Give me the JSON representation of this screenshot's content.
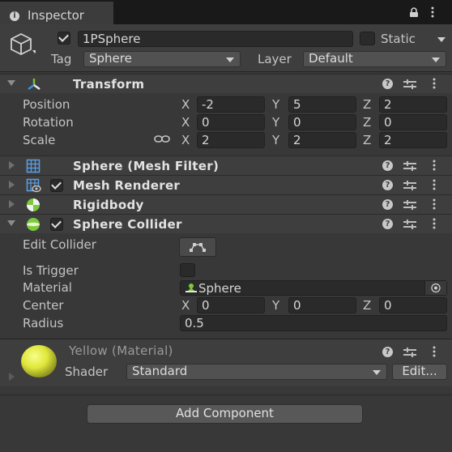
{
  "tab": {
    "title": "Inspector"
  },
  "gameobject": {
    "active": true,
    "name": "1PSphere",
    "static_label": "Static",
    "static_checked": false,
    "tag_label": "Tag",
    "tag_value": "Sphere",
    "layer_label": "Layer",
    "layer_value": "Default"
  },
  "transform": {
    "title": "Transform",
    "position_label": "Position",
    "rotation_label": "Rotation",
    "scale_label": "Scale",
    "axis_x": "X",
    "axis_y": "Y",
    "axis_z": "Z",
    "position": {
      "x": "-2",
      "y": "5",
      "z": "2"
    },
    "rotation": {
      "x": "0",
      "y": "0",
      "z": "0"
    },
    "scale": {
      "x": "2",
      "y": "2",
      "z": "2"
    }
  },
  "mesh_filter": {
    "title": "Sphere (Mesh Filter)"
  },
  "mesh_renderer": {
    "title": "Mesh Renderer",
    "enabled": true
  },
  "rigidbody": {
    "title": "Rigidbody"
  },
  "sphere_collider": {
    "title": "Sphere Collider",
    "enabled": true,
    "edit_collider_label": "Edit Collider",
    "is_trigger_label": "Is Trigger",
    "is_trigger": false,
    "material_label": "Material",
    "material_value": "Sphere",
    "center_label": "Center",
    "center": {
      "x": "0",
      "y": "0",
      "z": "0"
    },
    "radius_label": "Radius",
    "radius": "0.5"
  },
  "material": {
    "title": "Yellow (Material)",
    "shader_label": "Shader",
    "shader_value": "Standard",
    "edit_label": "Edit...",
    "preview_color": "#e6ef3c"
  },
  "add_component_label": "Add Component",
  "icons": {
    "tab": "info-icon",
    "gameobject": "cube-icon",
    "transform": "transform-axes-icon",
    "mesh_filter": "grid-mesh-icon",
    "mesh_renderer": "mesh-renderer-icon",
    "rigidbody": "rigidbody-icon",
    "sphere_collider": "sphere-collider-icon",
    "help": "help-icon",
    "presets": "presets-icon",
    "menu": "kebab-menu-icon"
  }
}
